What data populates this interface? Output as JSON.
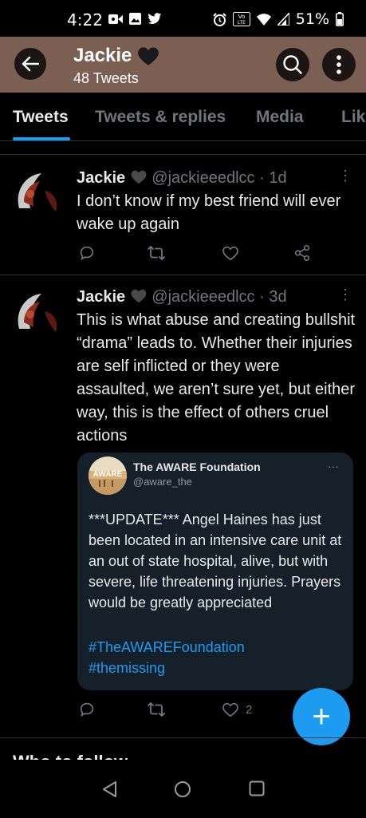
{
  "status_bar": {
    "time": "4:22",
    "battery": "51%",
    "left_icons": [
      "video-icon",
      "image-icon",
      "twitter-icon"
    ],
    "right_icons": [
      "alarm-icon",
      "volte-icon",
      "wifi-icon",
      "signal-icon",
      "battery-icon"
    ],
    "volte_label": "Vo LTE"
  },
  "header": {
    "title": "Jackie",
    "subtitle": "48 Tweets",
    "accent_color": "#7a5f52"
  },
  "tabs": [
    {
      "label": "Tweets",
      "active": true
    },
    {
      "label": "Tweets & replies",
      "active": false
    },
    {
      "label": "Media",
      "active": false
    },
    {
      "label": "Lik",
      "active": false
    }
  ],
  "tweets": [
    {
      "name": "Jackie",
      "handle": "@jackieeedlcc",
      "time": "· 1d",
      "text": "I don’t know if my best friend will ever wake up again"
    },
    {
      "name": "Jackie",
      "handle": "@jackieeedlcc",
      "time": "· 3d",
      "text": "This is what abuse and creating bullshit “drama” leads to. Whether their injuries are self inflicted or they were assaulted, we aren’t sure yet, but either way, this is the effect of others cruel actions",
      "likes": "2",
      "quote": {
        "name": "The AWARE Foundation",
        "handle": "@aware_the",
        "avatar_text": "AWARE",
        "more": "···",
        "text": "***UPDATE*** Angel Haines has just been located in an intensive care unit at an out of state hospital, alive, but with severe, life threatening injuries. Prayers would be greatly appreciated",
        "hashtags": [
          "#TheAWAREFoundation",
          "#themissing"
        ]
      }
    }
  ],
  "more_glyph": "⋮",
  "fab_label": "+",
  "section_heading": "Who to follow",
  "colors": {
    "link": "#1d9bf0",
    "muted": "#71767b",
    "quote_bg": "#16202b"
  }
}
